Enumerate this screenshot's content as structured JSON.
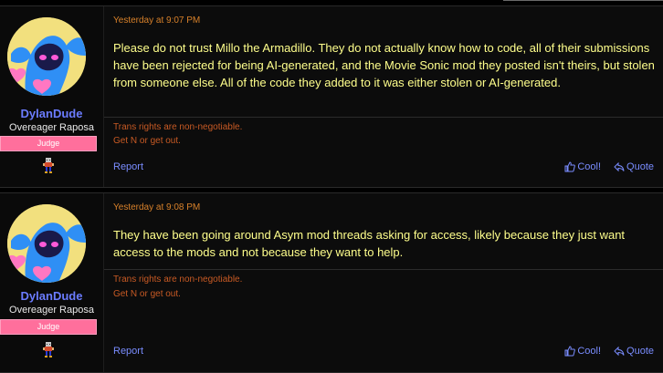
{
  "posts": [
    {
      "username": "DylanDude",
      "user_title": "Overeager Raposa",
      "badge": "Judge",
      "timestamp": "Yesterday at 9:07 PM",
      "body": "Please do not trust Millo the Armadillo. They do not actually know how to code, all of their submissions have been rejected for being AI-generated, and the Movie Sonic mod they posted isn't theirs, but stolen from someone else. All of the code they added to it was either stolen or AI-generated.",
      "signature": [
        "Trans rights are non-negotiable.",
        "Get N or get out."
      ],
      "report_label": "Report",
      "like_label": "Cool!",
      "quote_label": "Quote"
    },
    {
      "username": "DylanDude",
      "user_title": "Overeager Raposa",
      "badge": "Judge",
      "timestamp": "Yesterday at 9:08 PM",
      "body": "They have been going around Asym mod threads asking for access, likely because they just want access to the mods and not because they want to help.",
      "signature": [
        "Trans rights are non-negotiable.",
        "Get N or get out."
      ],
      "report_label": "Report",
      "like_label": "Cool!",
      "quote_label": "Quote"
    }
  ],
  "colors": {
    "background": "#000000",
    "username": "#6b7cff",
    "badge": "#ff6f9c",
    "timestamp": "#d8812a",
    "body_text": "#ffff8c",
    "signature": "#c85a24",
    "links": "#7a8dff"
  },
  "icons": {
    "like": "thumbs-up-icon",
    "quote": "quote-reply-icon"
  }
}
